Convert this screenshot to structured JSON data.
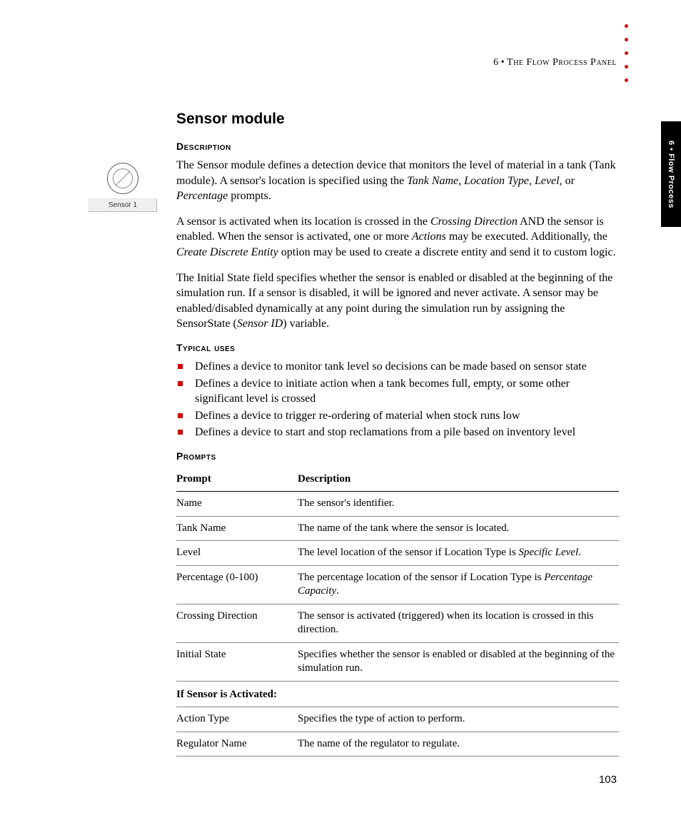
{
  "header": {
    "chapter_number": "6",
    "separator": " • ",
    "chapter_title": "The Flow Process Panel"
  },
  "side_tab": "6 • Flow Process",
  "figure": {
    "caption": "Sensor 1"
  },
  "title": "Sensor module",
  "sections": {
    "description_h": "Description",
    "desc_p1_a": "The Sensor module defines a detection device that monitors the level of material in a tank (Tank module). A sensor's location is specified using the ",
    "desc_p1_tn": "Tank Name",
    "desc_p1_b": ", ",
    "desc_p1_lt": "Location Type",
    "desc_p1_c": ", ",
    "desc_p1_lv": "Level",
    "desc_p1_d": ", or ",
    "desc_p1_pc": "Percentage",
    "desc_p1_e": " prompts.",
    "desc_p2_a": "A sensor is activated when its location is crossed in the ",
    "desc_p2_cd": "Crossing Direction",
    "desc_p2_b": " AND the sensor is enabled. When the sensor is activated, one or more ",
    "desc_p2_ac": "Actions",
    "desc_p2_c": " may be executed. Additionally, the ",
    "desc_p2_cde": "Create Discrete Entity",
    "desc_p2_d": " option may be used to create a discrete entity and send it to custom logic.",
    "desc_p3_a": "The Initial State field specifies whether the sensor is enabled or disabled at the beginning of the simulation run. If a sensor is disabled, it will be ignored and never activate. A sensor may be enabled/disabled dynamically at any point during the simulation run by assigning the SensorState (",
    "desc_p3_si": "Sensor ID",
    "desc_p3_b": ") variable.",
    "typical_h": "Typical uses",
    "uses": [
      "Defines a device to monitor tank level so decisions can be made based on sensor state",
      "Defines a device to initiate action when a tank becomes full, empty, or some other significant level is crossed",
      "Defines a device to trigger re-ordering of material when stock runs low",
      "Defines a device to start and stop reclamations from a pile based on inventory level"
    ],
    "prompts_h": "Prompts"
  },
  "table": {
    "col1": "Prompt",
    "col2": "Description",
    "rows": [
      {
        "p": "Name",
        "d_a": "The sensor's identifier.",
        "d_i": "",
        "d_b": ""
      },
      {
        "p": "Tank Name",
        "d_a": "The name of the tank where the sensor is located.",
        "d_i": "",
        "d_b": ""
      },
      {
        "p": "Level",
        "d_a": "The level location of the sensor if Location Type is ",
        "d_i": "Specific Level",
        "d_b": "."
      },
      {
        "p": "Percentage (0-100)",
        "d_a": "The percentage location of the sensor if Location Type is ",
        "d_i": "Percentage Capacity",
        "d_b": "."
      },
      {
        "p": "Crossing Direction",
        "d_a": "The sensor is activated (triggered) when its location is crossed in this direction.",
        "d_i": "",
        "d_b": ""
      },
      {
        "p": "Initial State",
        "d_a": "Specifies whether the sensor is enabled or disabled at the beginning of the simulation run.",
        "d_i": "",
        "d_b": ""
      }
    ],
    "section_row": "If Sensor is Activated:",
    "rows2": [
      {
        "p": "Action Type",
        "d_a": "Specifies the type of action to perform.",
        "d_i": "",
        "d_b": ""
      },
      {
        "p": "Regulator Name",
        "d_a": "The name of the regulator to regulate.",
        "d_i": "",
        "d_b": ""
      }
    ]
  },
  "page_number": "103"
}
